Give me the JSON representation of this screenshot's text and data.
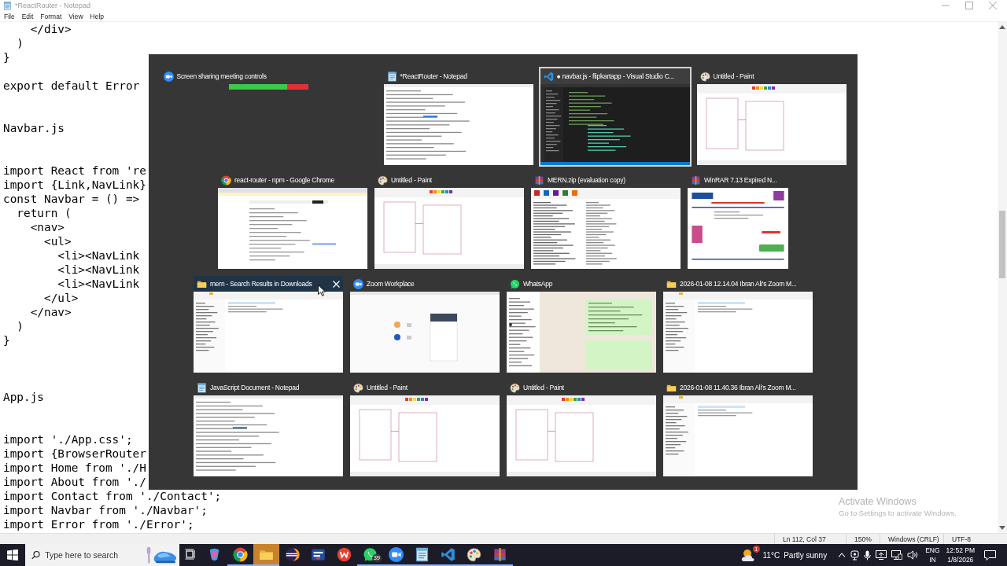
{
  "notepad": {
    "title": "*ReactRouter - Notepad",
    "menu": [
      "File",
      "Edit",
      "Format",
      "View",
      "Help"
    ],
    "lines": [
      {
        "kind": "code",
        "text": "    </div>"
      },
      {
        "kind": "code",
        "text": "  )"
      },
      {
        "kind": "code",
        "text": "}"
      },
      {
        "kind": "blank"
      },
      {
        "kind": "code",
        "text": "export default Error"
      },
      {
        "kind": "blank"
      },
      {
        "kind": "blank"
      },
      {
        "kind": "code",
        "text": "Navbar.js"
      },
      {
        "kind": "blank"
      },
      {
        "kind": "blank"
      },
      {
        "kind": "code",
        "text": "import React from 're"
      },
      {
        "kind": "code",
        "text": "import {Link,NavLink}"
      },
      {
        "kind": "code",
        "text": "const Navbar = () =>"
      },
      {
        "kind": "code",
        "text": "  return ("
      },
      {
        "kind": "code",
        "text": "    <nav>"
      },
      {
        "kind": "code",
        "text": "      <ul>"
      },
      {
        "kind": "code",
        "text": "        <li><NavLink"
      },
      {
        "kind": "code",
        "text": "        <li><NavLink"
      },
      {
        "kind": "code",
        "text": "        <li><NavLink"
      },
      {
        "kind": "code",
        "text": "      </ul>"
      },
      {
        "kind": "code",
        "text": "    </nav>"
      },
      {
        "kind": "code",
        "text": "  )"
      },
      {
        "kind": "code",
        "text": "}"
      },
      {
        "kind": "blank"
      },
      {
        "kind": "blank"
      },
      {
        "kind": "blank"
      },
      {
        "kind": "code",
        "text": "App.js"
      },
      {
        "kind": "blank"
      },
      {
        "kind": "blank"
      },
      {
        "kind": "code",
        "text": "import './App.css';"
      },
      {
        "kind": "code",
        "text": "import {BrowserRouter"
      },
      {
        "kind": "code",
        "text": "import Home from './H"
      },
      {
        "kind": "code",
        "text": "import About from './"
      },
      {
        "kind": "code",
        "text": "import Contact from './Contact';"
      },
      {
        "kind": "code",
        "text": "import Navbar from './Navbar';"
      },
      {
        "kind": "code",
        "text": "import Error from './Error';"
      }
    ],
    "status": [
      "Ln 112, Col 37",
      "150%",
      "Windows (CRLF)",
      "UTF-8"
    ]
  },
  "activation": {
    "title": "Activate Windows",
    "message": "Go to Settings to activate Windows."
  },
  "switcher": {
    "rows": [
      {
        "items": [
          {
            "title": "Screen sharing meeting controls",
            "kind": "zoom",
            "thumbnail": {
              "kind": "toolbar"
            },
            "selected": false,
            "hovered": false
          },
          {
            "title": "*ReactRouter - Notepad",
            "kind": "notepad",
            "thumbnail": {
              "kind": "notepad"
            },
            "selected": false,
            "hovered": false
          },
          {
            "title": "● navbar.js - flipkartapp - Visual Studio C...",
            "kind": "vscode",
            "thumbnail": {
              "kind": "code"
            },
            "selected": true,
            "hovered": false
          },
          {
            "title": "Untitled - Paint",
            "kind": "paint",
            "thumbnail": {
              "kind": "paint"
            },
            "selected": false,
            "hovered": false
          }
        ]
      },
      {
        "items": [
          {
            "title": "react-router - npm - Google Chrome",
            "kind": "chrome",
            "thumbnail": {
              "kind": "browser"
            },
            "selected": false,
            "hovered": false
          },
          {
            "title": "Untitled - Paint",
            "kind": "paint",
            "thumbnail": {
              "kind": "paint"
            },
            "selected": false,
            "hovered": false
          },
          {
            "title": "MERN.zip (evaluation copy)",
            "kind": "winrar",
            "thumbnail": {
              "kind": "archive"
            },
            "selected": false,
            "hovered": false
          },
          {
            "title": "WinRAR 7.13 Expired N...",
            "kind": "winrar",
            "thumbnail": {
              "kind": "dialog"
            },
            "selected": false,
            "hovered": false
          }
        ]
      },
      {
        "items": [
          {
            "title": "mern - Search Results in Downloads",
            "kind": "explorer",
            "thumbnail": {
              "kind": "explorer"
            },
            "selected": false,
            "hovered": true
          },
          {
            "title": "Zoom Workplace",
            "kind": "zoom",
            "thumbnail": {
              "kind": "zoom"
            },
            "selected": false,
            "hovered": false
          },
          {
            "title": "WhatsApp",
            "kind": "whatsapp",
            "thumbnail": {
              "kind": "chat"
            },
            "selected": false,
            "hovered": false
          },
          {
            "title": "2026-01-08 12.14.04 Ibran Ali's Zoom M...",
            "kind": "folder",
            "thumbnail": {
              "kind": "explorer"
            },
            "selected": false,
            "hovered": false
          }
        ]
      },
      {
        "items": [
          {
            "title": "JavaScript Document - Notepad",
            "kind": "notepad",
            "thumbnail": {
              "kind": "notepad"
            },
            "selected": false,
            "hovered": false
          },
          {
            "title": "Untitled - Paint",
            "kind": "paint",
            "thumbnail": {
              "kind": "paint"
            },
            "selected": false,
            "hovered": false
          },
          {
            "title": "Untitled - Paint",
            "kind": "paint",
            "thumbnail": {
              "kind": "paint"
            },
            "selected": false,
            "hovered": false
          },
          {
            "title": "2026-01-08 11.40.36 Ibran Ali's Zoom M...",
            "kind": "folder",
            "thumbnail": {
              "kind": "explorer"
            },
            "selected": false,
            "hovered": false
          }
        ]
      }
    ]
  },
  "taskbar": {
    "search": {
      "placeholder": "Type here to search"
    },
    "apps": [
      {
        "kind": "copilot",
        "active": false,
        "running": false
      },
      {
        "kind": "chrome",
        "active": false,
        "running": true
      },
      {
        "kind": "explorer",
        "active": true,
        "running": true
      },
      {
        "kind": "eclipse",
        "active": false,
        "running": false
      },
      {
        "kind": "devhub",
        "active": false,
        "running": false
      },
      {
        "kind": "wps",
        "active": false,
        "running": false
      },
      {
        "kind": "whatsapp",
        "active": false,
        "running": true,
        "badge": "39"
      },
      {
        "kind": "zoom",
        "active": false,
        "running": true
      },
      {
        "kind": "notepad",
        "active": false,
        "running": true
      },
      {
        "kind": "vscode",
        "active": false,
        "running": true
      },
      {
        "kind": "paint",
        "active": false,
        "running": true
      },
      {
        "kind": "winrar",
        "active": false,
        "running": true
      }
    ],
    "weather": {
      "temperature": "11°C",
      "condition": "Partly sunny",
      "badge": "1"
    },
    "language": [
      "ENG",
      "IN"
    ],
    "clock": {
      "time": "12:52 PM",
      "date": "1/8/2026"
    }
  }
}
